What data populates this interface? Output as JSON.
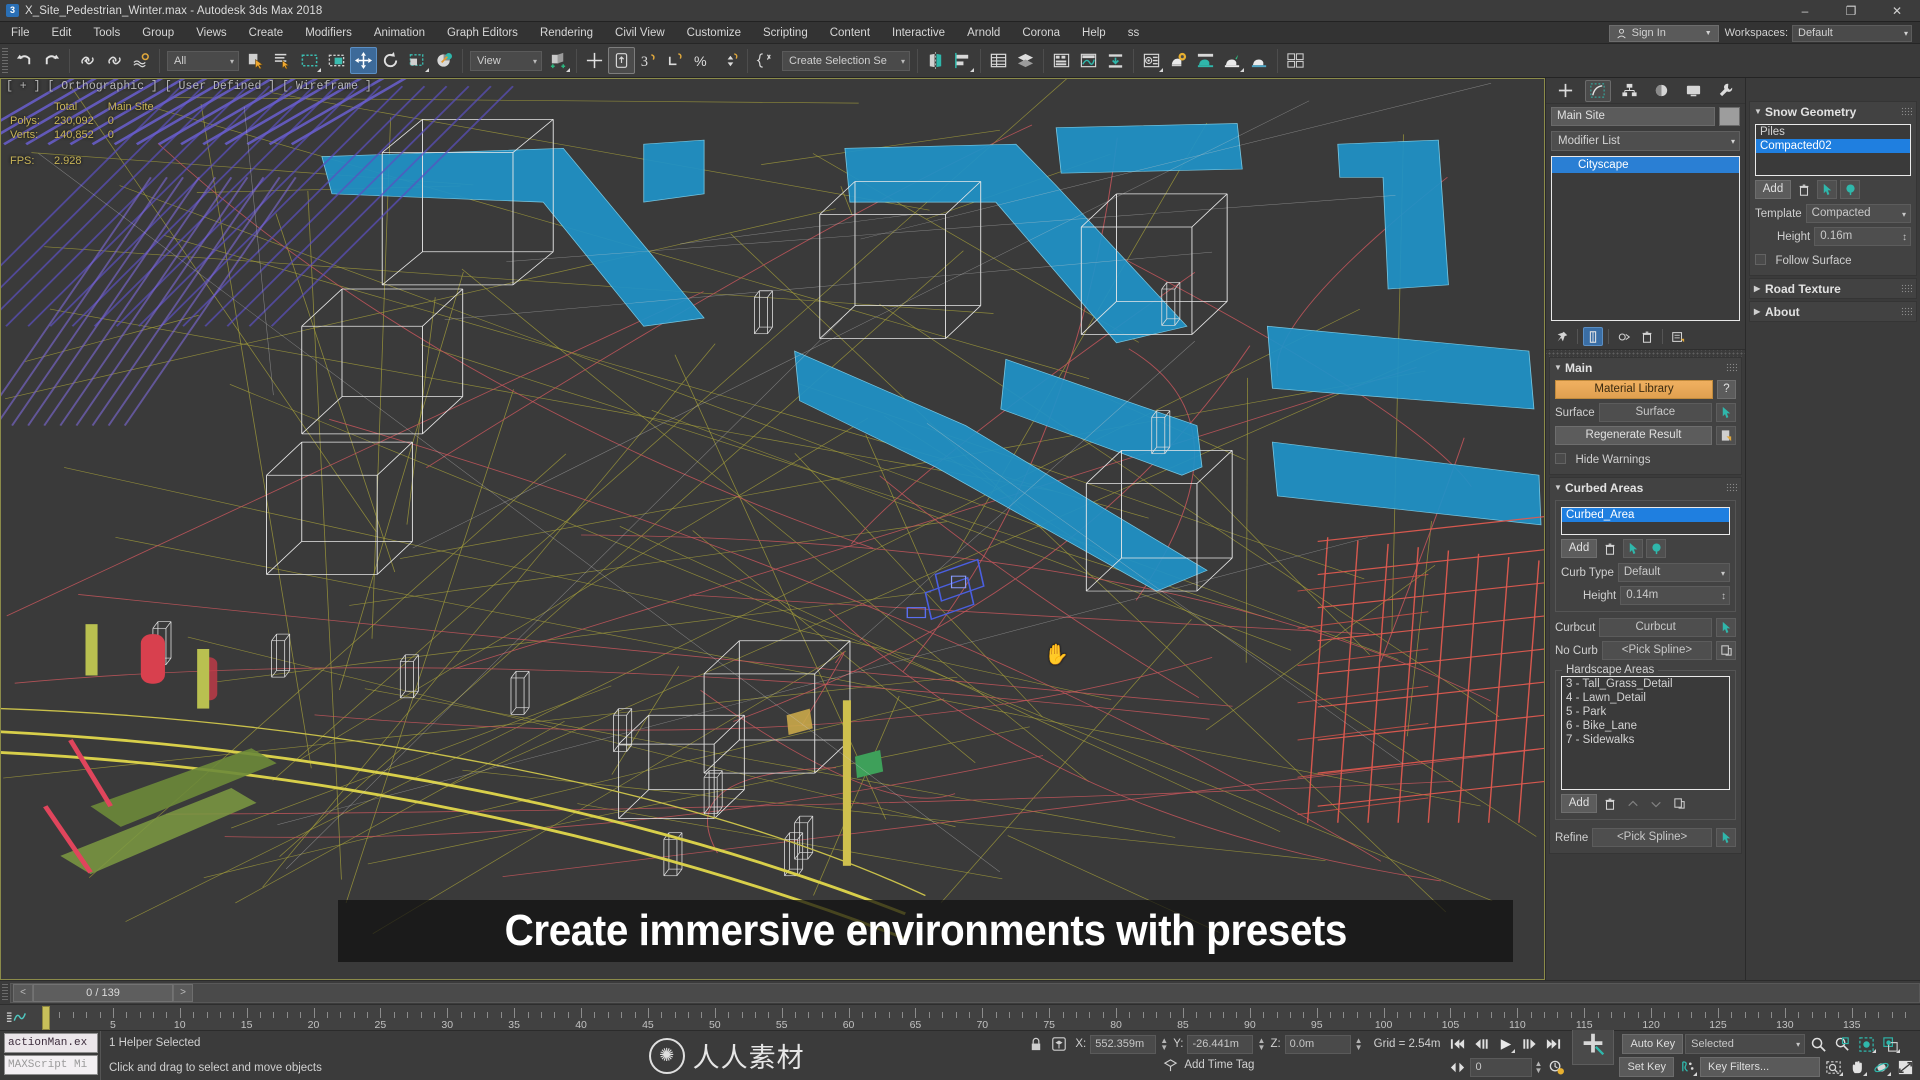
{
  "titlebar": {
    "icon": "max-app-icon",
    "title": "X_Site_Pedestrian_Winter.max - Autodesk 3ds Max 2018",
    "minimize": "–",
    "maximize": "❐",
    "close": "✕"
  },
  "menubar": {
    "items": [
      "File",
      "Edit",
      "Tools",
      "Group",
      "Views",
      "Create",
      "Modifiers",
      "Animation",
      "Graph Editors",
      "Rendering",
      "Civil View",
      "Customize",
      "Scripting",
      "Content",
      "Interactive",
      "Arnold",
      "Corona",
      "Help",
      "ss"
    ],
    "signin": "Sign In",
    "workspaces_label": "Workspaces:",
    "workspace_value": "Default"
  },
  "toolbar": {
    "selection_filter": "All",
    "reference_coord": "View",
    "named_selection_sets": "Create Selection Se",
    "buttons": [
      {
        "name": "undo-button",
        "icon": "undo-arrow-icon"
      },
      {
        "name": "redo-button",
        "icon": "redo-arrow-icon"
      },
      {
        "name": "select-and-link-button",
        "icon": "link-icon"
      },
      {
        "name": "unlink-selection-button",
        "icon": "unlink-icon"
      },
      {
        "name": "bind-to-space-warp-button",
        "icon": "space-warp-icon"
      },
      {
        "name": "select-object-button",
        "icon": "arrow-cursor-icon"
      },
      {
        "name": "select-by-name-button",
        "icon": "list-cursor-icon"
      },
      {
        "name": "rectangular-selection-region-button",
        "icon": "dashed-rect-icon"
      },
      {
        "name": "window-crossing-toggle-button",
        "icon": "window-crossing-icon"
      },
      {
        "name": "select-and-move-button",
        "icon": "move-gizmo-icon"
      },
      {
        "name": "select-and-rotate-button",
        "icon": "rotate-icon"
      },
      {
        "name": "select-and-scale-button",
        "icon": "scale-icon"
      },
      {
        "name": "select-and-place-button",
        "icon": "place-icon"
      },
      {
        "name": "use-center-flyout-button",
        "icon": "pivot-center-icon"
      },
      {
        "name": "select-and-manipulate-button",
        "icon": "manipulate-icon"
      },
      {
        "name": "snaps-toggle-button",
        "icon": "snap-3-icon"
      },
      {
        "name": "angle-snap-toggle-button",
        "icon": "angle-snap-icon"
      },
      {
        "name": "percent-snap-toggle-button",
        "icon": "percent-snap-icon"
      },
      {
        "name": "spinner-snap-toggle-button",
        "icon": "spinner-snap-icon"
      },
      {
        "name": "edit-named-selection-sets-button",
        "icon": "named-sets-icon"
      },
      {
        "name": "mirror-button",
        "icon": "mirror-icon"
      },
      {
        "name": "align-flyout-button",
        "icon": "align-icon"
      },
      {
        "name": "toggle-scene-explorer-button",
        "icon": "scene-explorer-icon"
      },
      {
        "name": "toggle-layer-explorer-button",
        "icon": "layers-icon"
      },
      {
        "name": "toggle-ribbon-button",
        "icon": "ribbon-icon"
      },
      {
        "name": "curve-editor-button",
        "icon": "curve-editor-icon"
      },
      {
        "name": "schematic-view-button",
        "icon": "schematic-view-icon"
      },
      {
        "name": "material-editor-button",
        "icon": "material-editor-icon"
      },
      {
        "name": "render-setup-button",
        "icon": "render-setup-gear-icon"
      },
      {
        "name": "rendered-frame-window-button",
        "icon": "render-frame-icon"
      },
      {
        "name": "render-production-button",
        "icon": "render-teapot-icon"
      },
      {
        "name": "render-iterative-button",
        "icon": "render-iterative-icon"
      },
      {
        "name": "project-folder-button",
        "icon": "project-folder-icon"
      }
    ]
  },
  "viewport": {
    "label": "[ + ] [ Orthographic ] [ User Defined ] [ Wireframe ]",
    "stats": {
      "col_total": "Total",
      "col_object": "Main Site",
      "polys_label": "Polys:",
      "polys_total": "230,092",
      "polys_object": "0",
      "verts_label": "Verts:",
      "verts_total": "140,852",
      "verts_object": "0",
      "fps_label": "FPS:",
      "fps_value": "2.928"
    },
    "cursor_icon": "hand-cursor-icon",
    "caption": "Create immersive environments with presets"
  },
  "command_panel": {
    "tabs": [
      {
        "name": "tab-create",
        "icon": "plus-icon",
        "selected": false
      },
      {
        "name": "tab-modify",
        "icon": "modify-bend-icon",
        "selected": true
      },
      {
        "name": "tab-hierarchy",
        "icon": "hierarchy-icon",
        "selected": false
      },
      {
        "name": "tab-motion",
        "icon": "motion-wheel-icon",
        "selected": false
      },
      {
        "name": "tab-display",
        "icon": "display-monitor-icon",
        "selected": false
      },
      {
        "name": "tab-utilities",
        "icon": "wrench-icon",
        "selected": false
      }
    ],
    "object_name": "Main Site",
    "modifier_list_label": "Modifier List",
    "modifier_stack": [
      "Cityscape"
    ],
    "stack_buttons": [
      {
        "name": "pin-stack-button",
        "icon": "pin-icon"
      },
      {
        "name": "show-end-result-button",
        "icon": "show-end-result-icon"
      },
      {
        "name": "make-unique-button",
        "icon": "make-unique-icon"
      },
      {
        "name": "remove-modifier-button",
        "icon": "trash-icon"
      },
      {
        "name": "configure-modifier-sets-button",
        "icon": "configure-sets-icon"
      }
    ],
    "rollouts": {
      "main": {
        "title": "Main",
        "material_library": "Material Library",
        "help": "?",
        "surface_label": "Surface",
        "surface_value": "Surface",
        "regenerate": "Regenerate Result",
        "hide_warnings": "Hide Warnings"
      },
      "curbed_areas": {
        "title": "Curbed Areas",
        "list": [
          "Curbed_Area"
        ],
        "add": "Add",
        "curb_type_label": "Curb Type",
        "curb_type_value": "Default",
        "height_label": "Height",
        "height_value": "0.14m",
        "curbcut_label": "Curbcut",
        "curbcut_value": "Curbcut",
        "nocurb_label": "No Curb",
        "nocurb_value": "<Pick Spline>",
        "hardscape_title": "Hardscape Areas",
        "hardscape_list": [
          "3 - Tall_Grass_Detail",
          "4 - Lawn_Detail",
          "5 - Park",
          "6 - Bike_Lane",
          "7 - Sidewalks"
        ],
        "hardscape_add": "Add",
        "refine_label": "Refine",
        "refine_value": "<Pick Spline>"
      }
    }
  },
  "right_panel": {
    "snow_geometry": {
      "title": "Snow Geometry",
      "list": [
        "Piles",
        "Compacted02"
      ],
      "selected_index": 1,
      "add": "Add",
      "template_label": "Template",
      "template_value": "Compacted",
      "height_label": "Height",
      "height_value": "0.16m",
      "follow_surface": "Follow Surface"
    },
    "road_texture": {
      "title": "Road Texture"
    },
    "about": {
      "title": "About"
    }
  },
  "timeslider": {
    "prev_frame": "<",
    "next_frame": ">",
    "current": "0 / 139"
  },
  "trackbar": {
    "curve_icon": "track-curve-icon",
    "ticks": [
      0,
      5,
      10,
      15,
      20,
      25,
      30,
      35,
      40,
      45,
      50,
      55,
      60,
      65,
      70,
      75,
      80,
      85,
      90,
      95,
      100,
      105,
      110,
      115,
      120,
      125,
      130,
      135
    ],
    "playhead_frame": 0
  },
  "statusbar": {
    "maxscript_line1": "actionMan.ex",
    "maxscript_line2": "MAXScript Mi",
    "selection_status": "1 Helper Selected",
    "prompt": "Click and drag to select and move objects",
    "watermark_text": "人人素材",
    "coords": {
      "lock_icon": "selection-lock-icon",
      "axis_icon": "absolute-mode-icon",
      "x_label": "X:",
      "x_value": "552.359m",
      "y_label": "Y:",
      "y_value": "-26.441m",
      "z_label": "Z:",
      "z_value": "0.0m",
      "grid": "Grid = 2.54m"
    },
    "time_tag": "Add Time Tag",
    "playback": [
      {
        "name": "goto-start-button",
        "icon": "skip-start-icon"
      },
      {
        "name": "previous-frame-button",
        "icon": "step-back-icon"
      },
      {
        "name": "play-animation-button",
        "icon": "play-icon"
      },
      {
        "name": "next-frame-button",
        "icon": "step-forward-icon"
      },
      {
        "name": "goto-end-button",
        "icon": "skip-end-icon"
      }
    ],
    "key_mode_icon": "key-mode-toggle-icon",
    "frame_field": "0",
    "time_config_icon": "time-configuration-icon",
    "add_keys_icon": "set-keys-big-plus-icon",
    "auto_key": "Auto Key",
    "set_key": "Set Key",
    "key_filter_set": "Selected",
    "key_filters": "Key Filters...",
    "nav_buttons": [
      {
        "name": "zoom-button",
        "icon": "magnifier-icon"
      },
      {
        "name": "zoom-all-button",
        "icon": "zoom-all-icon"
      },
      {
        "name": "zoom-extents-button",
        "icon": "zoom-extents-icon"
      },
      {
        "name": "zoom-extents-all-button",
        "icon": "zoom-extents-all-icon"
      },
      {
        "name": "zoom-region-button",
        "icon": "zoom-region-icon"
      },
      {
        "name": "pan-view-button",
        "icon": "hand-pan-icon"
      },
      {
        "name": "orbit-button",
        "icon": "orbit-icon"
      },
      {
        "name": "maximize-viewport-button",
        "icon": "maximize-viewport-icon"
      }
    ]
  }
}
